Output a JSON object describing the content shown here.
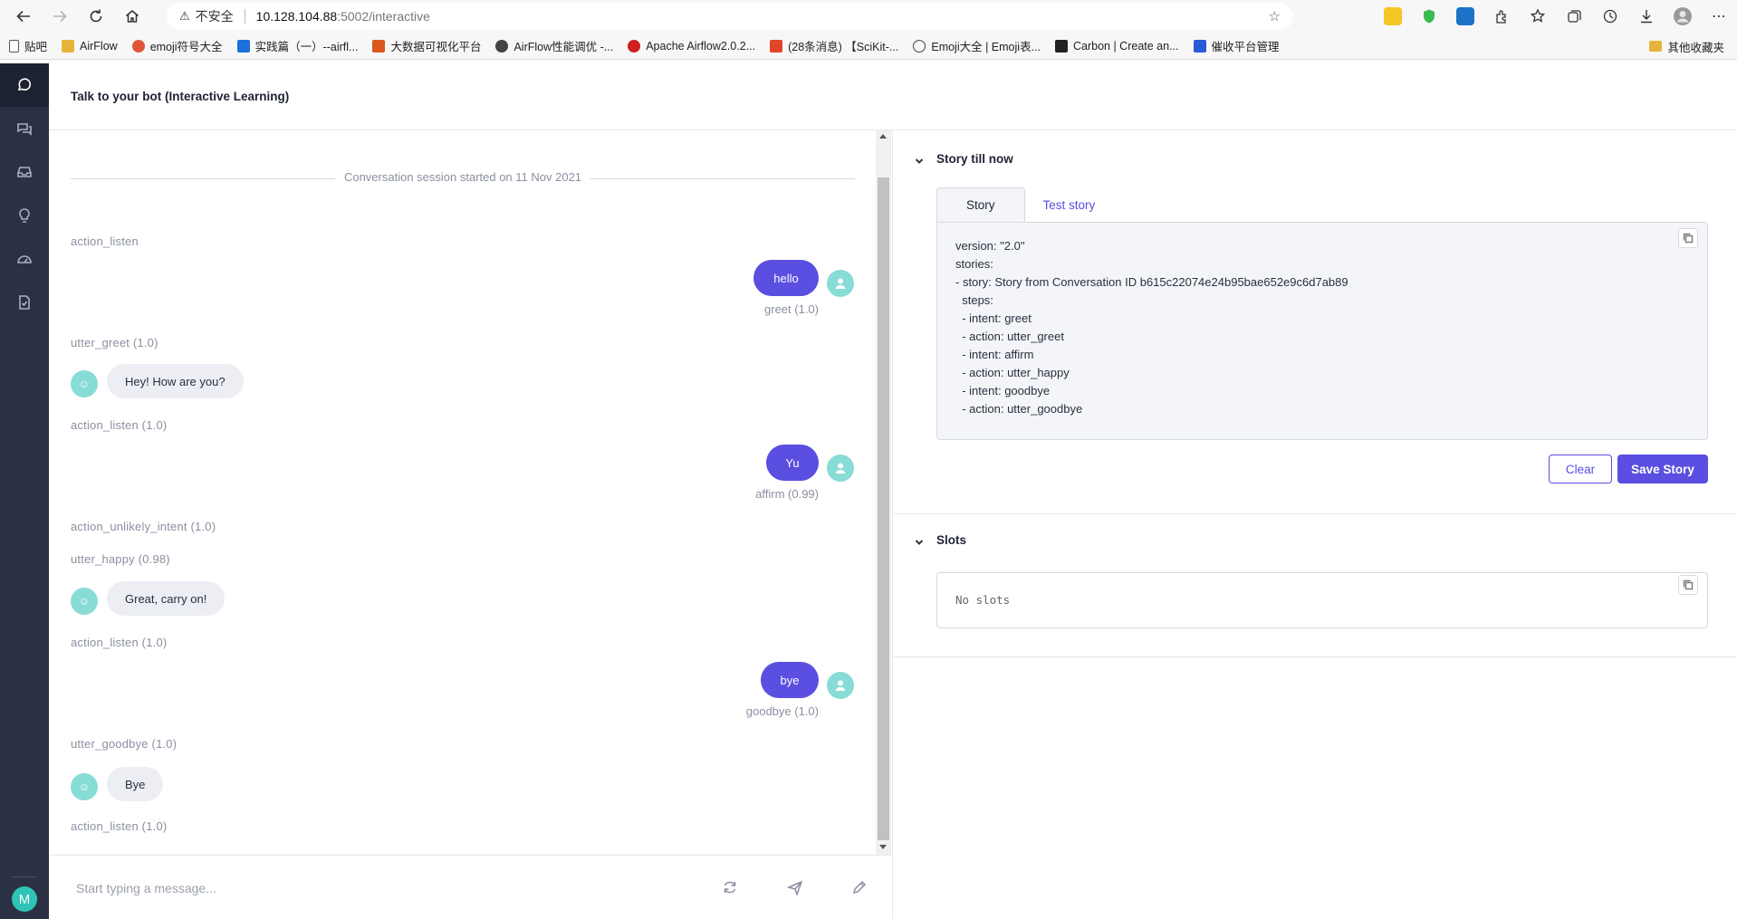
{
  "browser": {
    "security_icon": "warning-icon",
    "insecure_label": "不安全",
    "url_host": "10.128.104.88",
    "url_path": ":5002/interactive",
    "bookmarks": [
      {
        "label": "贴吧",
        "color": "#555555"
      },
      {
        "label": "AirFlow",
        "color": "#e8b33a"
      },
      {
        "label": "emoji符号大全",
        "color": "#e0563a"
      },
      {
        "label": "实践篇（一）--airfl...",
        "color": "#1e6fd9"
      },
      {
        "label": "大数据可视化平台",
        "color": "#d9581e"
      },
      {
        "label": "AirFlow性能调优 -...",
        "color": "#444444"
      },
      {
        "label": "Apache Airflow2.0.2...",
        "color": "#d01f1f"
      },
      {
        "label": "(28条消息) 【SciKit-...",
        "color": "#e2452a"
      },
      {
        "label": "Emoji大全 | Emoji表...",
        "color": "#444444"
      },
      {
        "label": "Carbon | Create an...",
        "color": "#222222"
      },
      {
        "label": "催收平台管理",
        "color": "#2a5bd7"
      }
    ],
    "other_bookmarks": "其他收藏夹"
  },
  "app": {
    "title": "Talk to your bot (Interactive Learning)",
    "user_initial": "M",
    "accent_color": "#5a4fe0"
  },
  "chat": {
    "session_started": "Conversation session started on 11 Nov 2021",
    "labels": {
      "a1": "action_listen",
      "a2": "utter_greet (1.0)",
      "a3": "action_listen (1.0)",
      "a4": "action_unlikely_intent (1.0)",
      "a5": "utter_happy (0.98)",
      "a6": "action_listen (1.0)",
      "a7": "utter_goodbye (1.0)",
      "a8": "action_listen (1.0)"
    },
    "user_messages": [
      {
        "text": "hello",
        "intent": "greet (1.0)"
      },
      {
        "text": "Yu",
        "intent": "affirm (0.99)"
      },
      {
        "text": "bye",
        "intent": "goodbye (1.0)"
      }
    ],
    "bot_messages": [
      {
        "text": "Hey! How are you?"
      },
      {
        "text": "Great, carry on!"
      },
      {
        "text": "Bye"
      }
    ],
    "composer_placeholder": "Start typing a message..."
  },
  "story": {
    "section_title": "Story till now",
    "tabs": [
      "Story",
      "Test story"
    ],
    "lines": [
      "version: \"2.0\"",
      "stories:",
      "- story: Story from Conversation ID b615c22074e24b95bae652e9c6d7ab89",
      "  steps:",
      "  - intent: greet",
      "  - action: utter_greet",
      "  - intent: affirm",
      "  - action: utter_happy",
      "  - intent: goodbye",
      "  - action: utter_goodbye"
    ],
    "clear_label": "Clear",
    "save_label": "Save Story"
  },
  "slots": {
    "section_title": "Slots",
    "empty_text": "No slots"
  }
}
